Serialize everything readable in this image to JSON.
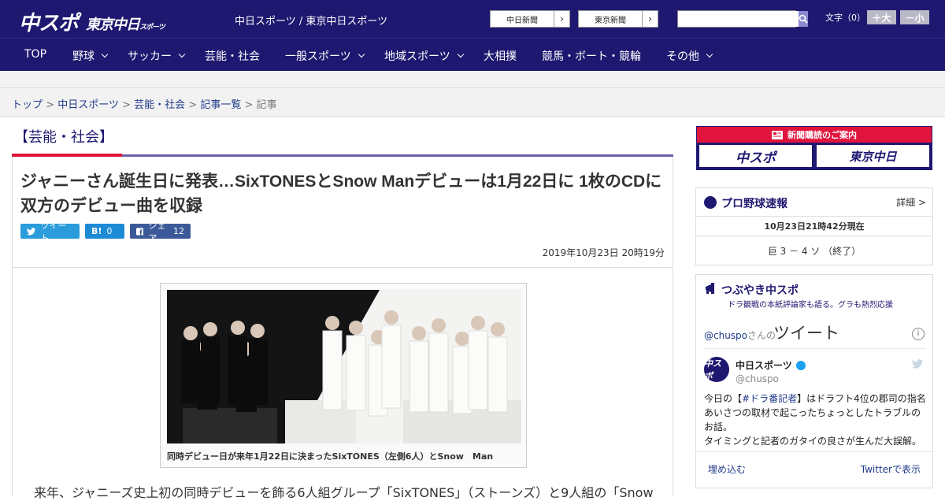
{
  "header": {
    "logo_main": "中スポ",
    "logo_tokyo": "東京中日",
    "logo_tokyo_small": "スポーツ",
    "site_name": "中日スポーツ / 東京中日スポーツ",
    "paper_buttons": [
      "中日新聞",
      "東京新聞"
    ],
    "paper_arrow": "›",
    "search_placeholder": "",
    "font_size_label": "文字（0）",
    "font_larger": "＋大",
    "font_smaller": "－小"
  },
  "nav": {
    "items": [
      {
        "label": "TOP"
      },
      {
        "label": "野球"
      },
      {
        "label": "サッカー"
      },
      {
        "label": "芸能・社会"
      },
      {
        "label": "一般スポーツ"
      },
      {
        "label": "地域スポーツ"
      },
      {
        "label": "大相撲"
      },
      {
        "label": "競馬・ボート・競輪"
      },
      {
        "label": "その他"
      }
    ]
  },
  "breadcrumb": {
    "items": [
      "トップ",
      "中日スポーツ",
      "芸能・社会",
      "記事一覧"
    ],
    "current": "記事",
    "separator": ">"
  },
  "article": {
    "category": "【芸能・社会】",
    "headline": "ジャニーさん誕生日に発表…SixTONESとSnow Manデビューは1月22日に 1枚のCDに双方のデビュー曲を収録",
    "share": {
      "tweet_label": "ツイート",
      "hatena_label": "B!",
      "hatena_count": "0",
      "facebook_label": "シェア",
      "facebook_count": "12"
    },
    "date": "2019年10月23日 20時19分",
    "photo_caption": "同時デビュー日が来年1月22日に決まったSixTONES（左側6人）とSnow　Man",
    "lead": "来年、ジャニーズ史上初の同時デビューを飾る6人組グループ「SixTONES」（ストーンズ）と9人組の「Snow"
  },
  "sidebar": {
    "ad": {
      "title": "新聞購読のご案内",
      "logo_left": "中スポ",
      "logo_right": "東京中日"
    },
    "baseball": {
      "title": "プロ野球速報",
      "detail": "詳細 >",
      "time": "10月23日21時42分現在",
      "score": "巨 3 － 4 ソ （終了）"
    },
    "tsubuyaki": {
      "title": "つぶやき中スポ",
      "subtitle": "ドラ観戦の本紙評論家も語る。グラも熱烈応援",
      "handle_prefix": "@chuspo",
      "handle_suffix": "さんの",
      "tweets_label": "ツイート",
      "info": "i",
      "account_name": "中日スポーツ",
      "account_user": "@chuspo",
      "avatar_text": "中スポ",
      "tweet_pre": "今日の【",
      "tweet_hash": "#ドラ番記者",
      "tweet_post": "】はドラフト4位の郡司の指名あいさつの取材で起こったちょっとしたトラブルのお話。",
      "tweet_line2": "タイミングと記者のガタイの良さが生んだ大誤解。",
      "embed_label": "埋め込む",
      "view_label": "Twitterで表示"
    }
  }
}
